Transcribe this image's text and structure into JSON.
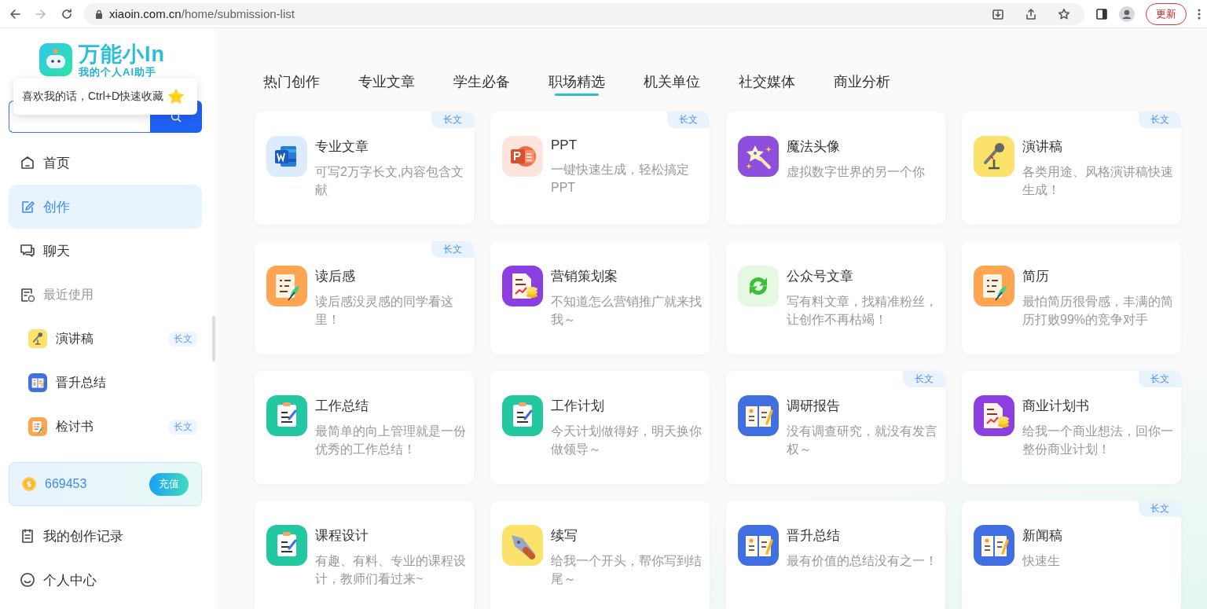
{
  "browser": {
    "url_domain": "xiaoin.com.cn",
    "url_path": "/home/submission-list",
    "update_button": "更新"
  },
  "sidebar": {
    "logo_title": "万能小In",
    "logo_subtitle": "我的个人AI助手",
    "tooltip": "喜欢我的话，Ctrl+D快速收藏",
    "nav": [
      {
        "label": "首页",
        "kind": "home",
        "selected": false
      },
      {
        "label": "创作",
        "kind": "edit",
        "selected": true
      },
      {
        "label": "聊天",
        "kind": "chat",
        "selected": false
      }
    ],
    "recent": {
      "title": "最近使用",
      "items": [
        {
          "label": "演讲稿",
          "kind": "mic",
          "badge": "长文"
        },
        {
          "label": "晋升总结",
          "kind": "book"
        },
        {
          "label": "检讨书",
          "kind": "scroll",
          "badge": "长文"
        }
      ]
    },
    "coins": {
      "amount": "669453",
      "button": "充值"
    },
    "bottom_nav": [
      {
        "label": "我的创作记录",
        "kind": "record",
        "selected": false
      },
      {
        "label": "个人中心",
        "kind": "smile",
        "selected": false
      }
    ]
  },
  "tabs": [
    {
      "label": "热门创作",
      "selected": false
    },
    {
      "label": "专业文章",
      "selected": false
    },
    {
      "label": "学生必备",
      "selected": false
    },
    {
      "label": "职场精选",
      "selected": true
    },
    {
      "label": "机关单位",
      "selected": false
    },
    {
      "label": "社交媒体",
      "selected": false
    },
    {
      "label": "商业分析",
      "selected": false
    }
  ],
  "cards": [
    {
      "title": "专业文章",
      "description": "可写2万字长文,内容包含文献",
      "kind": "word",
      "badge": "长文"
    },
    {
      "title": "PPT",
      "description": "一键快速生成，轻松搞定PPT",
      "kind": "ppt",
      "badge": "长文"
    },
    {
      "title": "魔法头像",
      "description": "虚拟数字世界的另一个你",
      "kind": "magic"
    },
    {
      "title": "演讲稿",
      "description": "各类用途、风格演讲稿快速生成！",
      "kind": "mic",
      "badge": "长文"
    },
    {
      "title": "读后感",
      "description": "读后感没灵感的同学看这里！",
      "kind": "scroll",
      "badge": "长文"
    },
    {
      "title": "营销策划案",
      "description": "不知道怎么营销推广就来找我～",
      "kind": "marketing"
    },
    {
      "title": "公众号文章",
      "description": "写有料文章，找精准粉丝，让创作不再枯竭！",
      "kind": "cycle"
    },
    {
      "title": "简历",
      "description": "最怕简历很骨感，丰满的简历打败99%的竞争对手",
      "kind": "scroll"
    },
    {
      "title": "工作总结",
      "description": "最简单的向上管理就是一份优秀的工作总结！",
      "kind": "clipboard"
    },
    {
      "title": "工作计划",
      "description": "今天计划做得好，明天换你做领导～",
      "kind": "clipboard"
    },
    {
      "title": "调研报告",
      "description": "没有调查研究，就没有发言权～",
      "kind": "book",
      "badge": "长文"
    },
    {
      "title": "商业计划书",
      "description": "给我一个商业想法，回你一整份商业计划！",
      "kind": "marketing",
      "badge": "长文"
    },
    {
      "title": "课程设计",
      "description": "有趣、有料、专业的课程设计，教师们看过来~",
      "kind": "clipboard"
    },
    {
      "title": "续写",
      "description": "给我一个开头，帮你写到结尾～",
      "kind": "pen"
    },
    {
      "title": "晋升总结",
      "description": "最有价值的总结没有之一！",
      "kind": "book"
    },
    {
      "title": "新闻稿",
      "description": "快速生",
      "kind": "book",
      "badge": "长文"
    }
  ]
}
